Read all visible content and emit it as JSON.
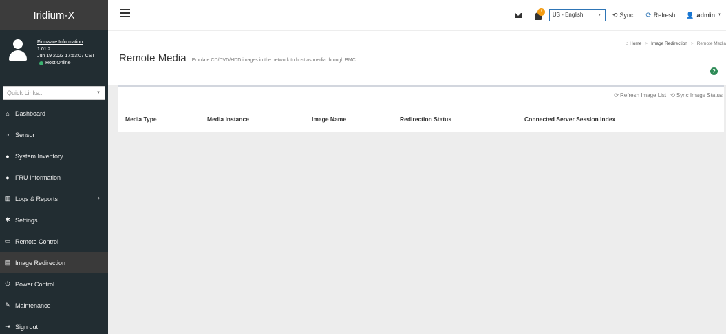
{
  "app": {
    "brand": "Iridium-X"
  },
  "user_panel": {
    "firmware_link": "Firmware Information",
    "version": "1.01.2",
    "build_date": "Jun 19 2023 17:53:07 CST",
    "host_status": "Host Online"
  },
  "quick_links": {
    "placeholder": "Quick Links.."
  },
  "sidebar": {
    "items": [
      {
        "label": "Dashboard",
        "icon": "home-icon"
      },
      {
        "label": "Sensor",
        "icon": "tachometer-icon"
      },
      {
        "label": "System Inventory",
        "icon": "info-icon"
      },
      {
        "label": "FRU Information",
        "icon": "info-icon"
      },
      {
        "label": "Logs & Reports",
        "icon": "bar-chart-icon",
        "chevron": "›"
      },
      {
        "label": "Settings",
        "icon": "gear-icon"
      },
      {
        "label": "Remote Control",
        "icon": "monitor-icon"
      },
      {
        "label": "Image Redirection",
        "icon": "hdd-icon",
        "active": true
      },
      {
        "label": "Power Control",
        "icon": "power-icon"
      },
      {
        "label": "Maintenance",
        "icon": "wrench-icon"
      },
      {
        "label": "Sign out",
        "icon": "sign-out-icon"
      }
    ]
  },
  "topbar": {
    "notification_count": "!",
    "language": "US - English",
    "sync_label": "Sync",
    "refresh_label": "Refresh",
    "user": "admin"
  },
  "header": {
    "title": "Remote Media",
    "subtitle": "Emulate CD/DVD/HDD images in the network to host as media through BMC",
    "breadcrumb": [
      "Home",
      "Image Redirection",
      "Remote Media"
    ]
  },
  "box": {
    "refresh_image_list": "Refresh Image List",
    "sync_image_status": "Sync Image Status",
    "columns": [
      "Media Type",
      "Media Instance",
      "Image Name",
      "Redirection Status",
      "Connected Server Session Index"
    ]
  },
  "colors": {
    "sidebar_bg": "#222d32",
    "accent": "#2e75b6",
    "online": "#3cb371",
    "badge": "#f39c12"
  }
}
